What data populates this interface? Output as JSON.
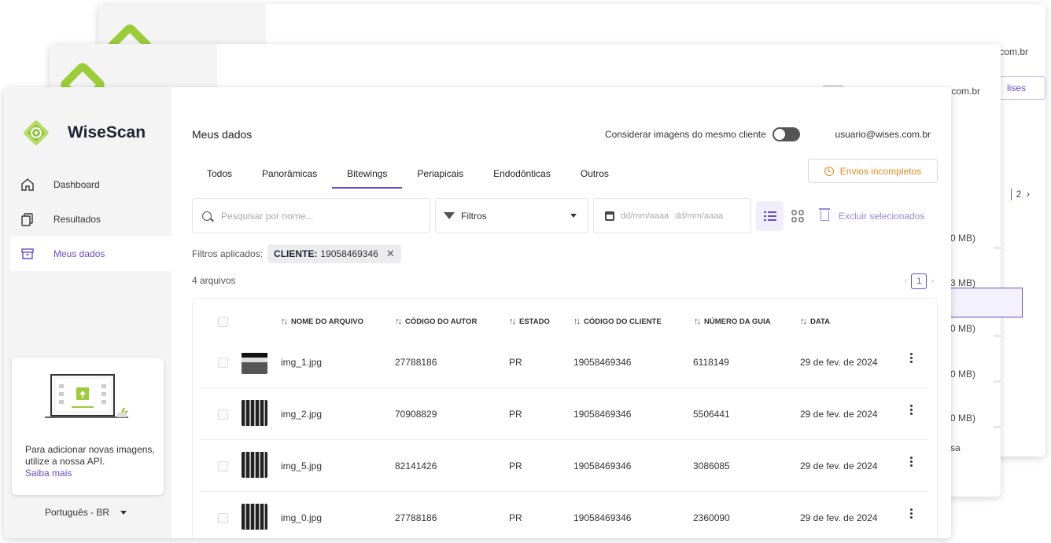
{
  "app": {
    "name": "WiseScan"
  },
  "background_windows": {
    "user_email_fragment": "com.br",
    "button_fragment": "lises",
    "pager_next": "2",
    "mb_fragments": [
      "0 MB)",
      "3 MB)",
      "0 MB)",
      "0 MB)",
      "0 MB)"
    ],
    "sa_fragment": "sa"
  },
  "sidebar": {
    "items": [
      {
        "label": "Dashboard",
        "icon": "home-icon",
        "active": false
      },
      {
        "label": "Resultados",
        "icon": "copy-icon",
        "active": false
      },
      {
        "label": "Meus dados",
        "icon": "archive-icon",
        "active": true
      }
    ],
    "api_card": {
      "text": "Para adicionar novas imagens, utilize a nossa API.",
      "link": "Saiba mais"
    },
    "language": "Português - BR"
  },
  "header": {
    "title": "Meus dados",
    "toggle_label": "Considerar imagens do mesmo cliente",
    "user_email": "usuario@wises.com.br"
  },
  "tabs": [
    {
      "label": "Todos",
      "active": false
    },
    {
      "label": "Panorâmicas",
      "active": false
    },
    {
      "label": "Bitewings",
      "active": true
    },
    {
      "label": "Periapicais",
      "active": false
    },
    {
      "label": "Endodônticas",
      "active": false
    },
    {
      "label": "Outros",
      "active": false
    }
  ],
  "incomplete_button": "Envios incompletos",
  "toolbar": {
    "search_placeholder": "Pesquisar por nome...",
    "filter_label": "Filtros",
    "date_from_placeholder": "dd/mm/aaaa",
    "date_to_placeholder": "dd/mm/aaaa",
    "delete_selected": "Excluir selecionados"
  },
  "applied_filters": {
    "label": "Filtros aplicados:",
    "chip_key": "CLIENTE:",
    "chip_value": "19058469346"
  },
  "file_count": "4 arquivos",
  "pagination": {
    "current": "1"
  },
  "table": {
    "headers": [
      "NOME DO ARQUIVO",
      "CÓDIGO DO AUTOR",
      "ESTADO",
      "CÓDIGO DO CLIENTE",
      "NÚMERO DA GUIA",
      "DATA"
    ],
    "rows": [
      {
        "name": "img_1.jpg",
        "author": "27788186",
        "state": "PR",
        "client": "19058469346",
        "guide": "6118149",
        "date": "29 de fev. de 2024"
      },
      {
        "name": "img_2.jpg",
        "author": "70908829",
        "state": "PR",
        "client": "19058469346",
        "guide": "5506441",
        "date": "29 de fev. de 2024"
      },
      {
        "name": "img_5.jpg",
        "author": "82141426",
        "state": "PR",
        "client": "19058469346",
        "guide": "3086085",
        "date": "29 de fev. de 2024"
      },
      {
        "name": "img_0.jpg",
        "author": "27788186",
        "state": "PR",
        "client": "19058469346",
        "guide": "2360090",
        "date": "29 de fev. de 2024"
      }
    ]
  },
  "colors": {
    "accent": "#6a4cc9",
    "brand_green": "#9ccc3a",
    "warning": "#e08b1f"
  }
}
